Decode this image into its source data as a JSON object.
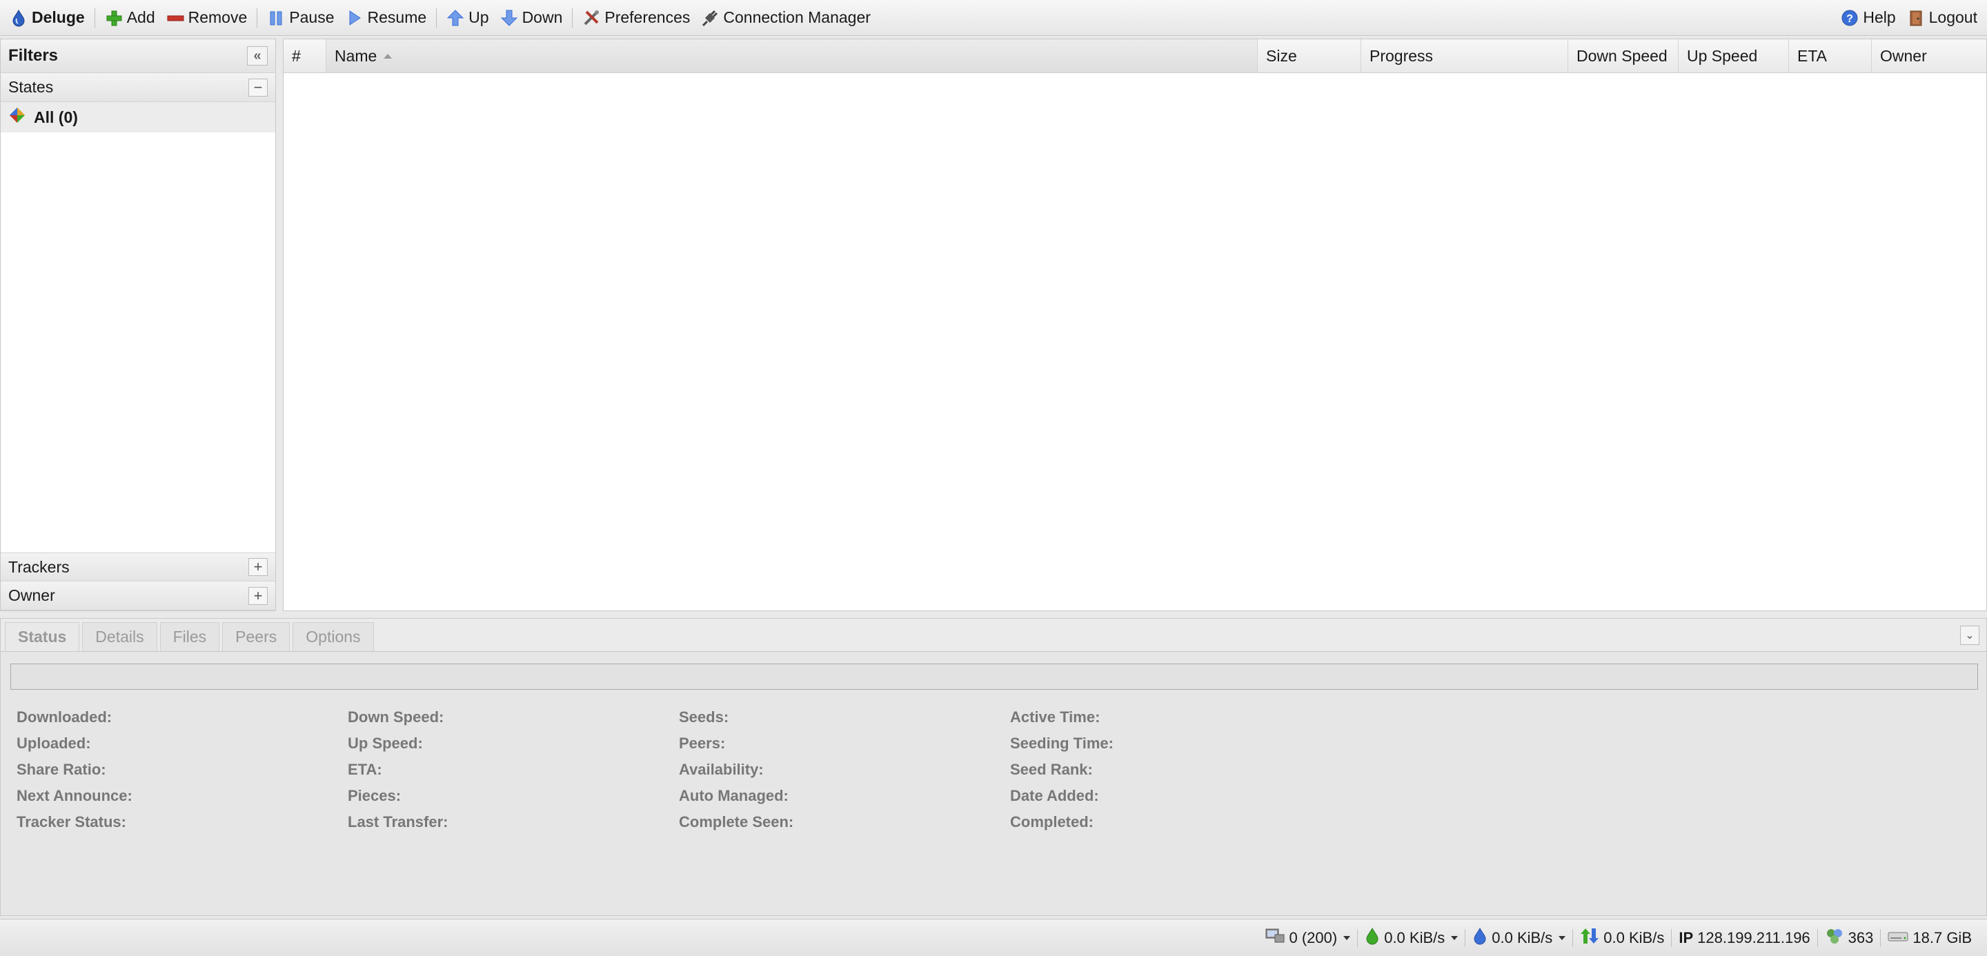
{
  "toolbar": {
    "app_title": "Deluge",
    "add": "Add",
    "remove": "Remove",
    "pause": "Pause",
    "resume": "Resume",
    "up": "Up",
    "down": "Down",
    "preferences": "Preferences",
    "connection_manager": "Connection Manager",
    "help": "Help",
    "logout": "Logout"
  },
  "filters": {
    "title": "Filters",
    "states": {
      "label": "States",
      "items": [
        {
          "label": "All (0)"
        }
      ]
    },
    "trackers": "Trackers",
    "owner": "Owner"
  },
  "grid": {
    "columns": [
      "#",
      "Name",
      "Size",
      "Progress",
      "Down Speed",
      "Up Speed",
      "ETA",
      "Owner"
    ],
    "sorted_column": "Name",
    "rows": []
  },
  "details": {
    "tabs": [
      "Status",
      "Details",
      "Files",
      "Peers",
      "Options"
    ],
    "active_tab": "Status",
    "stats": [
      [
        "Downloaded:",
        "Uploaded:",
        "Share Ratio:",
        "Next Announce:",
        "Tracker Status:"
      ],
      [
        "Down Speed:",
        "Up Speed:",
        "ETA:",
        "Pieces:",
        "Last Transfer:"
      ],
      [
        "Seeds:",
        "Peers:",
        "Availability:",
        "Auto Managed:",
        "Complete Seen:"
      ],
      [
        "Active Time:",
        "Seeding Time:",
        "Seed Rank:",
        "Date Added:",
        "Completed:"
      ]
    ]
  },
  "statusbar": {
    "connections": "0 (200)",
    "download_speed": "0.0 KiB/s",
    "upload_speed": "0.0 KiB/s",
    "protocol_traffic": "0.0 KiB/s",
    "ip_label": "IP",
    "ip_address": "128.199.211.196",
    "dht_nodes": "363",
    "free_space": "18.7 GiB"
  },
  "colors": {
    "accent_blue": "#3b6fd8",
    "add_green": "#3faa2a",
    "remove_red": "#c8352b"
  }
}
